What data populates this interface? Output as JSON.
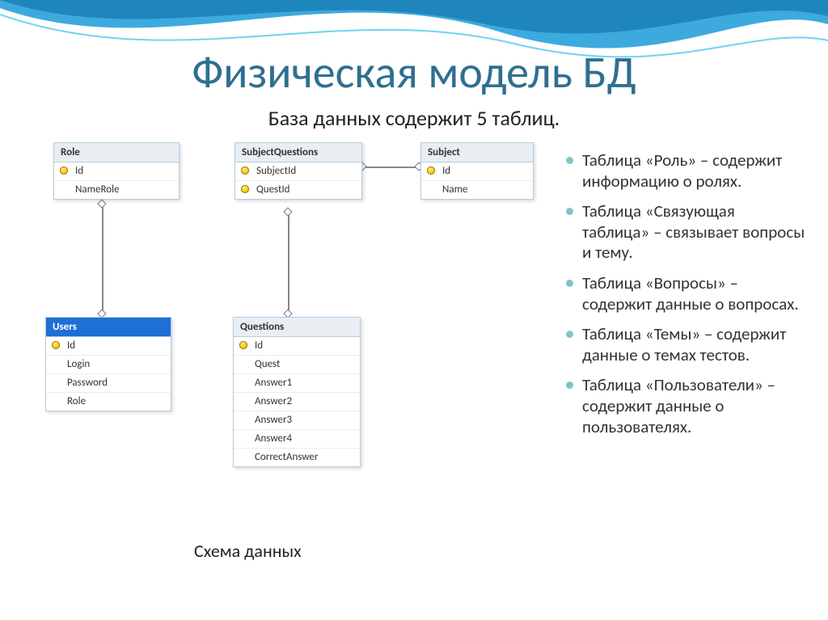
{
  "title": "Физическая модель БД",
  "subtitle": "База данных содержит 5 таблиц.",
  "caption": "Схема данных",
  "tables": {
    "role": {
      "name": "Role",
      "cols": [
        {
          "label": "Id",
          "pk": true
        },
        {
          "label": "NameRole",
          "pk": false
        }
      ]
    },
    "subjectQuestions": {
      "name": "SubjectQuestions",
      "cols": [
        {
          "label": "SubjectId",
          "pk": true
        },
        {
          "label": "QuestId",
          "pk": true
        }
      ]
    },
    "subject": {
      "name": "Subject",
      "cols": [
        {
          "label": "Id",
          "pk": true
        },
        {
          "label": "Name",
          "pk": false
        }
      ]
    },
    "users": {
      "name": "Users",
      "cols": [
        {
          "label": "Id",
          "pk": true
        },
        {
          "label": "Login",
          "pk": false
        },
        {
          "label": "Password",
          "pk": false
        },
        {
          "label": "Role",
          "pk": false
        }
      ]
    },
    "questions": {
      "name": "Questions",
      "cols": [
        {
          "label": "Id",
          "pk": true
        },
        {
          "label": "Quest",
          "pk": false
        },
        {
          "label": "Answer1",
          "pk": false
        },
        {
          "label": "Answer2",
          "pk": false
        },
        {
          "label": "Answer3",
          "pk": false
        },
        {
          "label": "Answer4",
          "pk": false
        },
        {
          "label": "CorrectAnswer",
          "pk": false
        }
      ]
    }
  },
  "bullets": [
    "Таблица «Роль» – содержит информацию о ролях.",
    "Таблица «Связующая таблица» – связывает вопросы и тему.",
    "Таблица «Вопросы» – содержит данные о вопросах.",
    "Таблица «Темы» – содержит данные о темах тестов.",
    "Таблица «Пользователи» – содержит данные о пользователях."
  ]
}
